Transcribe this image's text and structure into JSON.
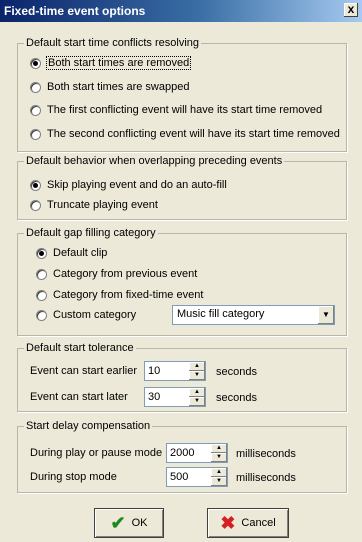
{
  "window": {
    "title": "Fixed-time event options",
    "close_label": "x"
  },
  "conflicts": {
    "legend": "Default start time conflicts resolving",
    "options": [
      {
        "label": "Both start times are removed",
        "selected": true
      },
      {
        "label": "Both start times are swapped",
        "selected": false
      },
      {
        "label": "The first conflicting event will have its start time removed",
        "selected": false
      },
      {
        "label": "The second conflicting event will have its start time removed",
        "selected": false
      }
    ]
  },
  "overlap": {
    "legend": "Default behavior when overlapping preceding events",
    "options": [
      {
        "label": "Skip playing event and do an auto-fill",
        "selected": true
      },
      {
        "label": "Truncate playing event",
        "selected": false
      }
    ]
  },
  "gap": {
    "legend": "Default gap filling category",
    "options": [
      {
        "label": "Default clip",
        "selected": true
      },
      {
        "label": "Category from previous event",
        "selected": false
      },
      {
        "label": "Category from fixed-time event",
        "selected": false
      },
      {
        "label": "Custom category",
        "selected": false
      }
    ],
    "custom_category_value": "Music fill category"
  },
  "tolerance": {
    "legend": "Default start tolerance",
    "earlier_label": "Event can start earlier",
    "earlier_value": "10",
    "later_label": "Event can start later",
    "later_value": "30",
    "unit": "seconds"
  },
  "delay": {
    "legend": "Start delay compensation",
    "play_label": "During play or pause mode",
    "play_value": "2000",
    "stop_label": "During stop mode",
    "stop_value": "500",
    "unit": "milliseconds"
  },
  "buttons": {
    "ok_label": "OK",
    "cancel_label": "Cancel"
  },
  "colors": {
    "dialog_bg": "#ECE9D8",
    "title_bar": "#0A246A",
    "ok_icon": "#1E8A1E",
    "cancel_icon": "#D42020"
  }
}
